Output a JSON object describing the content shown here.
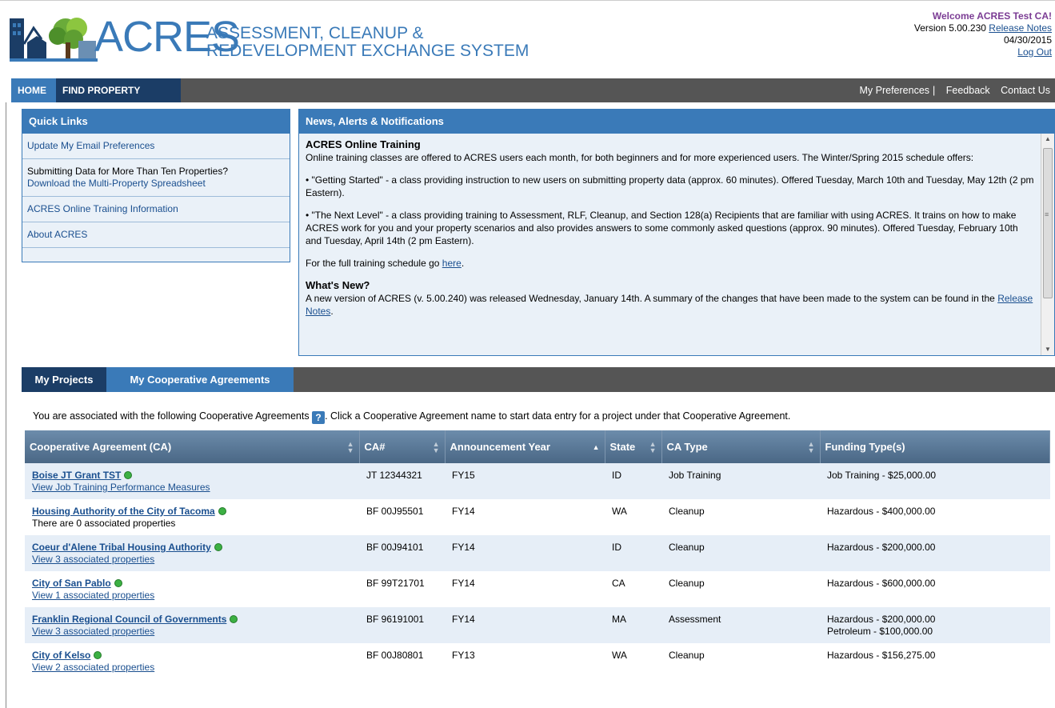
{
  "header": {
    "logo_word": "ACRES",
    "logo_sub_line1": "Assessment, Cleanup &",
    "logo_sub_line2": "Redevelopment Exchange System",
    "welcome": "Welcome ACRES Test CA!",
    "version_prefix": "Version 5.00.230",
    "release_notes_link": "Release Notes",
    "date": "04/30/2015",
    "logout": "Log Out"
  },
  "nav": {
    "home": "HOME",
    "find_property": "FIND PROPERTY",
    "my_preferences": "My Preferences",
    "feedback": "Feedback",
    "contact_us": "Contact Us"
  },
  "quick_links": {
    "title": "Quick Links",
    "update_email": "Update My Email Preferences",
    "submitting_text": "Submitting Data for More Than Ten Properties?",
    "download_spreadsheet": "Download the Multi-Property Spreadsheet",
    "training_info": "ACRES Online Training Information",
    "about": "About ACRES"
  },
  "news": {
    "title": "News, Alerts & Notifications",
    "training_title": "ACRES Online Training",
    "training_intro": "Online training classes are offered to ACRES users each month, for both beginners and for more experienced users. The Winter/Spring 2015 schedule offers:",
    "bullet1": "• \"Getting Started\" - a class providing instruction to new users on submitting property data (approx. 60 minutes). Offered Tuesday, March 10th and Tuesday, May 12th (2 pm Eastern).",
    "bullet2": "• \"The Next Level\" - a class providing training to Assessment, RLF, Cleanup, and Section 128(a) Recipients that are familiar with using ACRES. It trains on how to make ACRES work for you and your property scenarios and also provides answers to some commonly asked questions (approx. 90 minutes). Offered Tuesday, February 10th and Tuesday, April 14th (2 pm Eastern).",
    "schedule_text": "For the full training schedule go",
    "schedule_link": "here",
    "whats_new_title": "What's New?",
    "whats_new_text": "A new version of ACRES (v. 5.00.240) was released Wednesday, January 14th.  A summary of the changes that have been made to the system can be found in the",
    "release_notes_link": "Release Notes"
  },
  "project_tabs": {
    "my_projects": "My Projects",
    "my_cas": "My Cooperative Agreements"
  },
  "info": {
    "text1": "You are associated with the following Cooperative Agreements",
    "help": "?",
    "text2": ". Click a Cooperative Agreement name to start data entry for a project under that Cooperative Agreement."
  },
  "table": {
    "headers": [
      "Cooperative Agreement (CA)",
      "CA#",
      "Announcement Year",
      "State",
      "CA Type",
      "Funding Type(s)"
    ],
    "rows": [
      {
        "name": "Boise JT Grant TST",
        "sub": "View Job Training Performance Measures",
        "sub_link": true,
        "ca": "JT 12344321",
        "year": "FY15",
        "state": "ID",
        "type": "Job Training",
        "funding1": "Job Training - $25,000.00",
        "funding2": ""
      },
      {
        "name": "Housing Authority of the City of Tacoma",
        "sub": "There are 0 associated properties",
        "sub_link": false,
        "ca": "BF 00J95501",
        "year": "FY14",
        "state": "WA",
        "type": "Cleanup",
        "funding1": "Hazardous - $400,000.00",
        "funding2": ""
      },
      {
        "name": "Coeur d'Alene Tribal Housing Authority",
        "sub": "View 3 associated properties",
        "sub_link": true,
        "ca": "BF 00J94101",
        "year": "FY14",
        "state": "ID",
        "type": "Cleanup",
        "funding1": "Hazardous - $200,000.00",
        "funding2": ""
      },
      {
        "name": "City of San Pablo",
        "sub": "View 1 associated properties",
        "sub_link": true,
        "ca": "BF 99T21701",
        "year": "FY14",
        "state": "CA",
        "type": "Cleanup",
        "funding1": "Hazardous - $600,000.00",
        "funding2": ""
      },
      {
        "name": "Franklin Regional Council of Governments",
        "sub": "View 3 associated properties",
        "sub_link": true,
        "ca": "BF 96191001",
        "year": "FY14",
        "state": "MA",
        "type": "Assessment",
        "funding1": "Hazardous - $200,000.00",
        "funding2": "Petroleum - $100,000.00"
      },
      {
        "name": "City of Kelso",
        "sub": "View 2 associated properties",
        "sub_link": true,
        "ca": "BF 00J80801",
        "year": "FY13",
        "state": "WA",
        "type": "Cleanup",
        "funding1": "Hazardous - $156,275.00",
        "funding2": ""
      }
    ]
  },
  "colors": {
    "brand_blue": "#3a7ab8",
    "dark_navy": "#1b3d66",
    "status_green": "#3cb043",
    "welcome_purple": "#7b3c94"
  }
}
